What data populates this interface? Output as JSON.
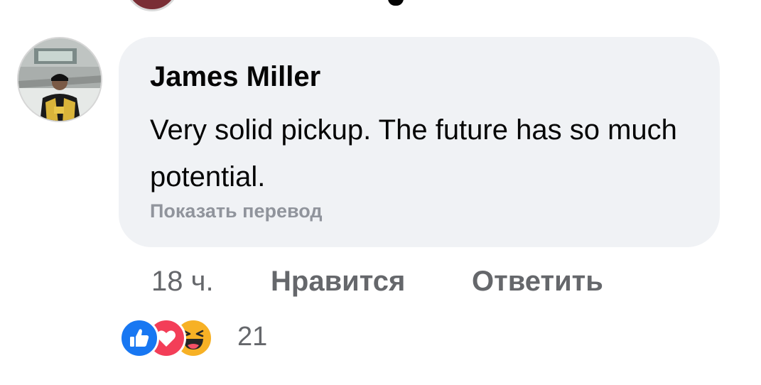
{
  "comment": {
    "author": "James Miller",
    "text": "Very solid pickup. The future has so much potential.",
    "translate_label": "Показать перевод",
    "timestamp": "18 ч.",
    "like_label": "Нравится",
    "reply_label": "Ответить",
    "reactions": {
      "icons": [
        "like-icon",
        "love-icon",
        "haha-icon"
      ],
      "count": "21"
    }
  },
  "colors": {
    "bubble": "#f0f2f5",
    "text_primary": "#050505",
    "text_secondary": "#65676b",
    "like_blue": "#1877f2",
    "love_red": "#f33e58",
    "haha_yellow": "#f7b125"
  }
}
